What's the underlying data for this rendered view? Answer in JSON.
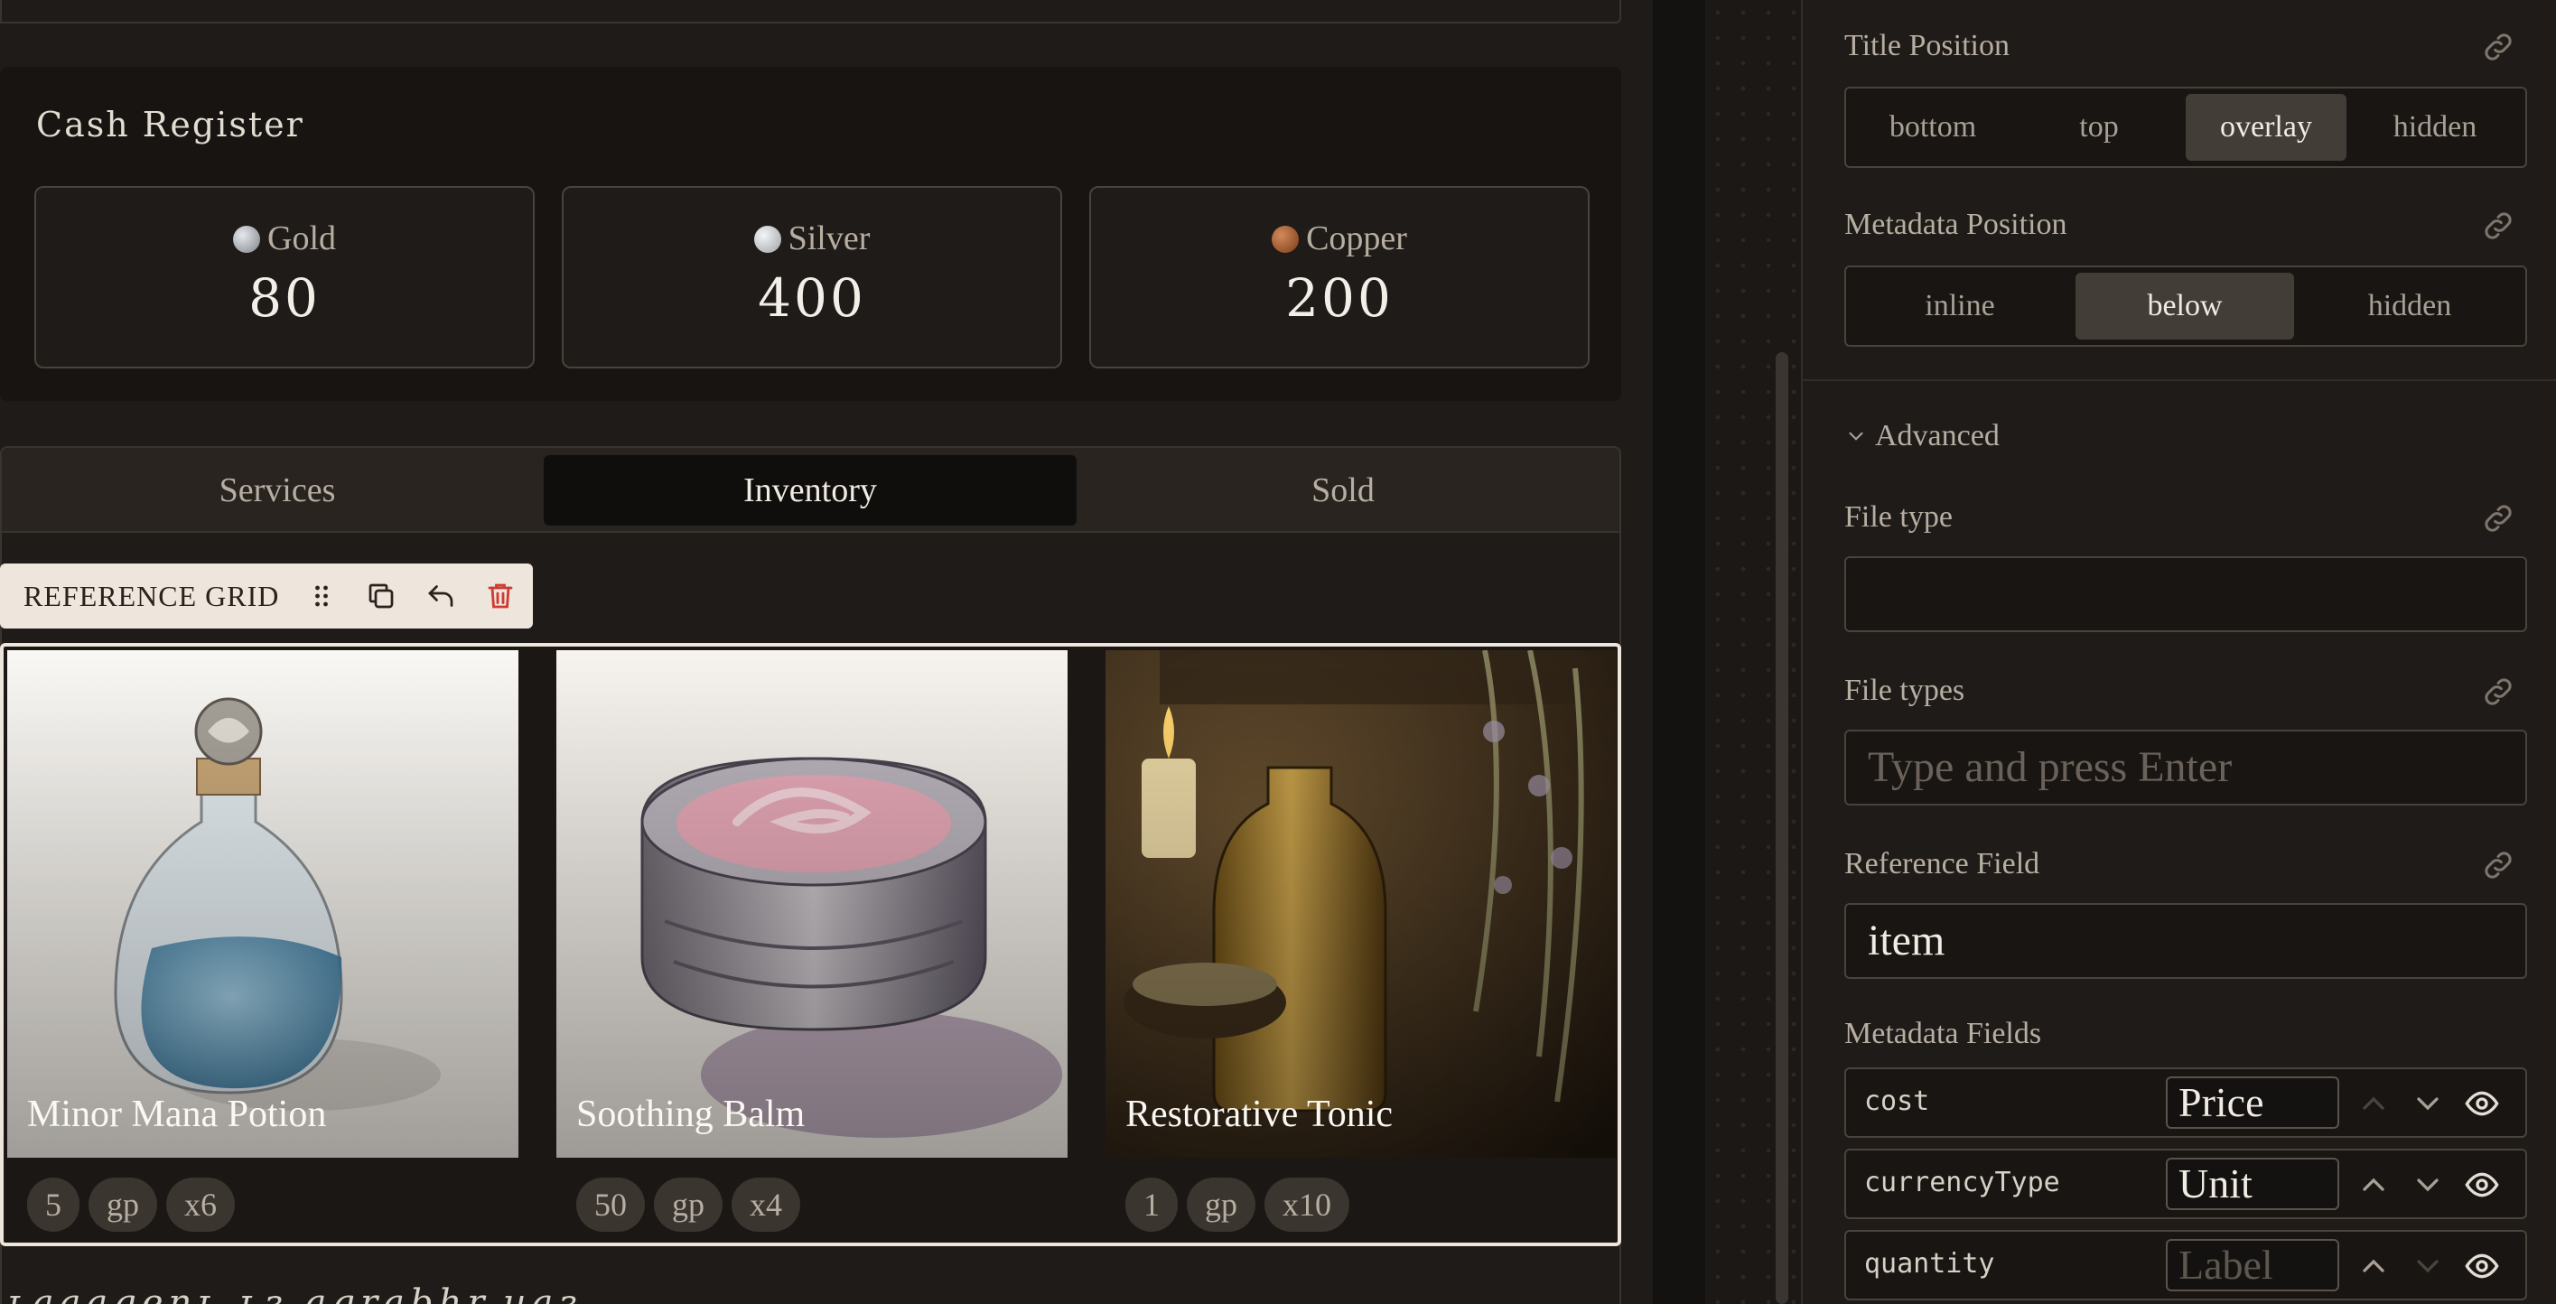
{
  "register": {
    "title": "Cash Register",
    "coins": [
      {
        "label": "Gold",
        "value": "80",
        "color": "#9aa0a8"
      },
      {
        "label": "Silver",
        "value": "400",
        "color": "#c9ccd0"
      },
      {
        "label": "Copper",
        "value": "200",
        "color": "#a0582e"
      }
    ]
  },
  "tabs": [
    "Services",
    "Inventory",
    "Sold"
  ],
  "active_tab": "Inventory",
  "reference_grid": {
    "label": "REFERENCE GRID",
    "toolbar_icons": [
      "drag-handle-icon",
      "duplicate-icon",
      "undo-icon",
      "delete-icon"
    ],
    "cards": [
      {
        "title": "Minor Mana Potion",
        "meta": [
          "5",
          "gp",
          "x6"
        ]
      },
      {
        "title": "Soothing Balm",
        "meta": [
          "50",
          "gp",
          "x4"
        ]
      },
      {
        "title": "Restorative Tonic",
        "meta": [
          "1",
          "gp",
          "x10"
        ]
      }
    ]
  },
  "below_text": "ʟaaagenʟ ʟɜ agrabhr.uaɜ",
  "panel": {
    "title_position": {
      "label": "Title Position",
      "options": [
        "bottom",
        "top",
        "overlay",
        "hidden"
      ],
      "selected": "overlay"
    },
    "metadata_position": {
      "label": "Metadata Position",
      "options": [
        "inline",
        "below",
        "hidden"
      ],
      "selected": "below"
    },
    "advanced_label": "Advanced",
    "file_type": {
      "label": "File type",
      "value": ""
    },
    "file_types": {
      "label": "File types",
      "placeholder": "Type and press Enter"
    },
    "reference_field": {
      "label": "Reference Field",
      "value": "item"
    },
    "metadata_fields": {
      "label": "Metadata Fields",
      "rows": [
        {
          "name": "cost",
          "label_value": "Price",
          "placeholder": ""
        },
        {
          "name": "currencyType",
          "label_value": "Unit",
          "placeholder": ""
        },
        {
          "name": "quantity",
          "label_value": "",
          "placeholder": "Label"
        }
      ]
    }
  },
  "colors": {
    "accent_delete": "#d03a32",
    "toolbar_bg": "#eee6dc",
    "panel_bg": "#1f1b18"
  }
}
